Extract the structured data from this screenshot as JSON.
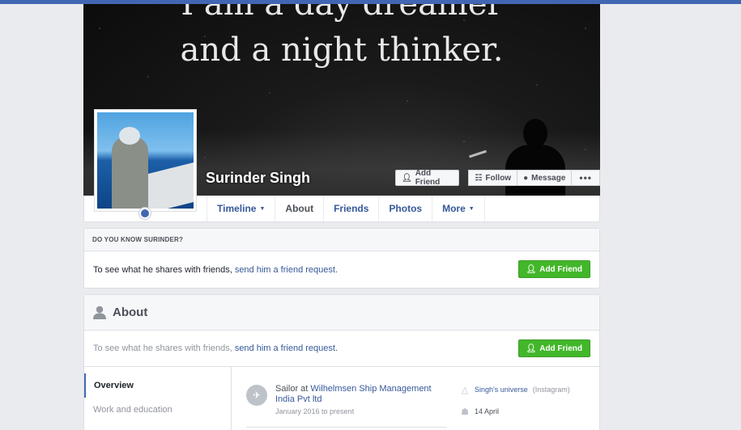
{
  "cover": {
    "quote_line1": "I am a day dreamer",
    "quote_line2": "and a night thinker."
  },
  "profile": {
    "name": "Surinder Singh"
  },
  "cover_buttons": {
    "add_friend": "Add Friend",
    "follow": "Follow",
    "message": "Message",
    "more": "•••"
  },
  "nav": {
    "tabs": [
      {
        "label": "Timeline"
      },
      {
        "label": "About"
      },
      {
        "label": "Friends"
      },
      {
        "label": "Photos"
      },
      {
        "label": "More"
      }
    ],
    "active": "About"
  },
  "know_card": {
    "header": "DO YOU KNOW SURINDER?",
    "text": "To see what he shares with friends,",
    "link": "send him a friend request.",
    "button": "Add Friend"
  },
  "about": {
    "title": "About",
    "prompt_text": "To see what he shares with friends,",
    "prompt_link": "send him a friend request.",
    "button": "Add Friend",
    "sections": [
      {
        "label": "Overview"
      },
      {
        "label": "Work and education"
      }
    ],
    "job": {
      "prefix": "Sailor at",
      "company": "Wilhelmsen Ship Management India Pvt ltd",
      "dates": "January 2016 to present"
    },
    "side": {
      "site": "Singh's universe",
      "site_source": "(Instagram)",
      "birthday": "14 April"
    }
  },
  "colors": {
    "brand_blue": "#4267b2",
    "link_blue": "#365899",
    "green": "#42b72a"
  }
}
